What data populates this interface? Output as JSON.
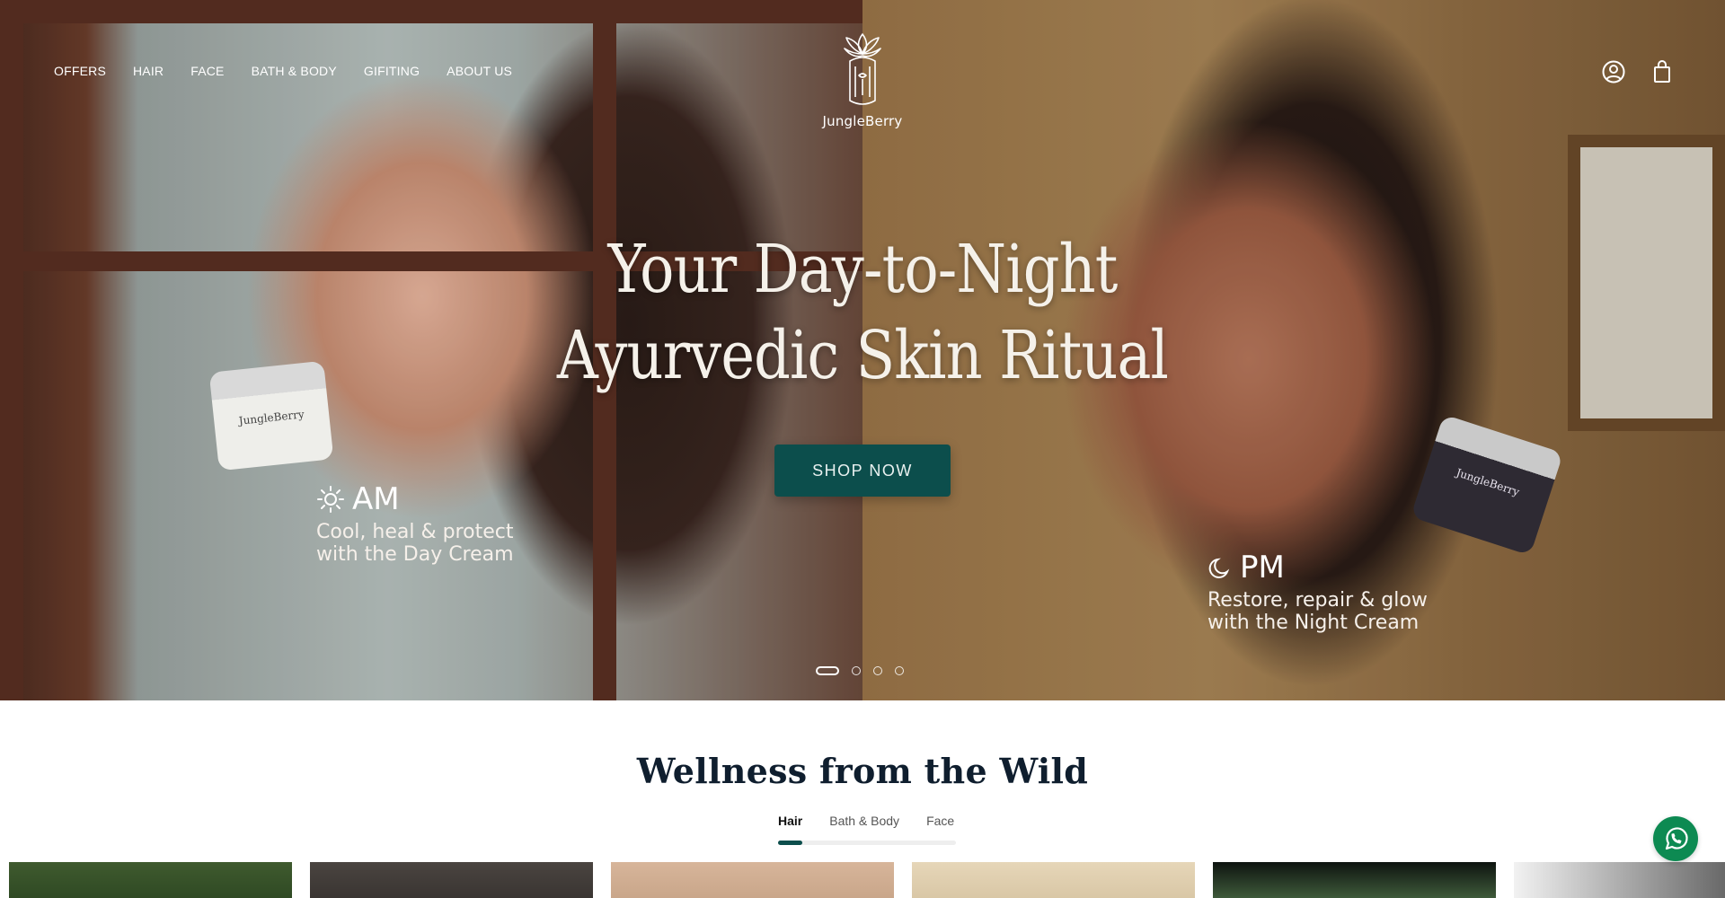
{
  "brand": {
    "name": "JungleBerry"
  },
  "nav": {
    "items": [
      {
        "label": "OFFERS"
      },
      {
        "label": "HAIR"
      },
      {
        "label": "FACE"
      },
      {
        "label": "BATH & BODY"
      },
      {
        "label": "GIFITING"
      },
      {
        "label": "ABOUT US"
      }
    ]
  },
  "header": {
    "account_icon": "user-circle-icon",
    "cart_icon": "shopping-bag-icon"
  },
  "hero": {
    "title_line1": "Your Day-to-Night",
    "title_line2": "Ayurvedic Skin Ritual",
    "cta_label": "SHOP NOW",
    "am": {
      "icon": "sun-icon",
      "heading": "AM",
      "line1": "Cool, heal & protect",
      "line2": "with the Day Cream"
    },
    "pm": {
      "icon": "moon-icon",
      "heading": "PM",
      "line1": "Restore, repair & glow",
      "line2": "with the Night Cream"
    },
    "jar_left_label": "JungleBerry",
    "jar_right_label": "JungleBerry",
    "slides_total": 4,
    "slide_active": 1
  },
  "section": {
    "title": "Wellness from the Wild",
    "tabs": [
      {
        "label": "Hair",
        "active": true
      },
      {
        "label": "Bath & Body",
        "active": false
      },
      {
        "label": "Face",
        "active": false
      }
    ]
  },
  "colors": {
    "accent": "#0c4e4c",
    "whatsapp": "#0d8a52",
    "title": "#0f1e2e"
  },
  "floating": {
    "whatsapp_icon": "whatsapp-icon"
  }
}
